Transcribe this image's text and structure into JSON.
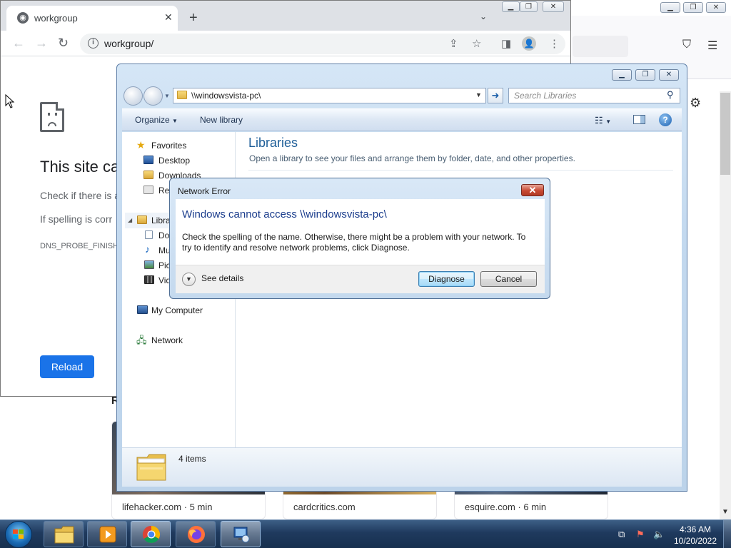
{
  "firefox": {
    "cards": [
      {
        "label": "lifehacker.com · 5 min"
      },
      {
        "label": "cardcritics.com"
      },
      {
        "label": "esquire.com · 6 min"
      }
    ],
    "partial_heading": "R"
  },
  "chrome": {
    "tab_title": "workgroup",
    "url": "workgroup/",
    "error_heading": "This site ca",
    "error_line1": "Check if there is a",
    "error_line2": "If spelling is corr",
    "error_code": "DNS_PROBE_FINISH",
    "reload_label": "Reload"
  },
  "explorer": {
    "address": "\\\\windowsvista-pc\\",
    "search_placeholder": "Search Libraries",
    "organize_label": "Organize",
    "new_library_label": "New library",
    "nav": {
      "favorites": "Favorites",
      "desktop": "Desktop",
      "downloads": "Downloads",
      "recent": "Rec",
      "libraries": "Libra",
      "documents": "Do",
      "music": "Mu",
      "pictures": "Pic",
      "videos": "Vid",
      "computer": "My Computer",
      "network": "Network"
    },
    "title": "Libraries",
    "description": "Open a library to see your files and arrange them by folder, date, and other properties.",
    "status": "4 items"
  },
  "dialog": {
    "title": "Network Error",
    "heading": "Windows cannot access \\\\windowsvista-pc\\",
    "message": "Check the spelling of the name. Otherwise, there might be a problem with your network. To try to identify and resolve network problems, click Diagnose.",
    "details_label": "See details",
    "diagnose_label": "Diagnose",
    "cancel_label": "Cancel"
  },
  "taskbar": {
    "time": "4:36 AM",
    "date": "10/20/2022"
  },
  "colors": {
    "chrome_button": "#1a73e8",
    "explorer_title": "#1e5e98",
    "dialog_heading": "#1a3c8c",
    "taskbar": "#1f3a5e"
  }
}
